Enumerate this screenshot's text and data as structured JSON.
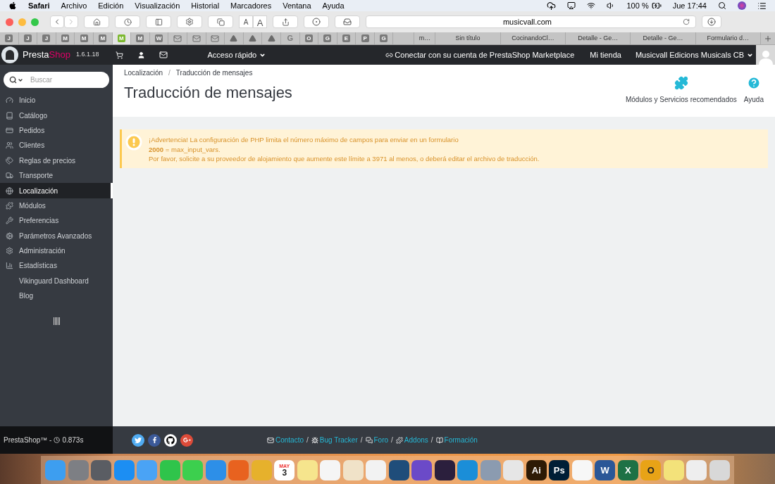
{
  "menu_bar": {
    "app": "Safari",
    "menus": [
      "Archivo",
      "Edición",
      "Visualización",
      "Historial",
      "Marcadores",
      "Ventana",
      "Ayuda"
    ],
    "battery": "100 %",
    "clock": "Jue 17:44"
  },
  "toolbar": {
    "font_buttons": [
      "A",
      "A"
    ],
    "url": "musicvall.com"
  },
  "favorite_tabs": [
    {
      "kind": "letter",
      "label": "J",
      "selected": false
    },
    {
      "kind": "letter",
      "label": "J",
      "selected": false
    },
    {
      "kind": "letter",
      "label": "J",
      "selected": false
    },
    {
      "kind": "letter",
      "label": "M",
      "selected": false
    },
    {
      "kind": "letter",
      "label": "M",
      "selected": false
    },
    {
      "kind": "letter",
      "label": "M",
      "selected": false
    },
    {
      "kind": "letter",
      "label": "M",
      "selected": true
    },
    {
      "kind": "letter",
      "label": "M",
      "selected": false
    },
    {
      "kind": "letter",
      "label": "W",
      "selected": false
    },
    {
      "kind": "mail",
      "selected": false
    },
    {
      "kind": "mail",
      "selected": false
    },
    {
      "kind": "mail",
      "selected": false
    },
    {
      "kind": "drive",
      "selected": false
    },
    {
      "kind": "drive",
      "selected": false
    },
    {
      "kind": "drive",
      "selected": false
    },
    {
      "kind": "plain",
      "label": "G",
      "selected": false
    },
    {
      "kind": "letter",
      "label": "O",
      "selected": false
    },
    {
      "kind": "letter",
      "label": "G",
      "selected": false
    },
    {
      "kind": "letter",
      "label": "E",
      "selected": false
    },
    {
      "kind": "letter",
      "label": "P",
      "selected": false
    },
    {
      "kind": "letter",
      "label": "G",
      "selected": false
    }
  ],
  "page_tabs": [
    {
      "label": "m…",
      "selected": false
    },
    {
      "label": "Sin título",
      "selected": false
    },
    {
      "label": "CocinandoCl…",
      "selected": false
    },
    {
      "label": "Detalle - Ge…",
      "selected": false
    },
    {
      "label": "Detalle - Ge…",
      "selected": false
    },
    {
      "label": "Formulario d…",
      "selected": false
    }
  ],
  "header": {
    "brand_prefix": "Presta",
    "brand_suffix": "Shop",
    "version": "1.6.1.18",
    "quick_access": "Acceso rápido",
    "marketplace": "Conectar con su cuenta de PrestaShop Marketplace",
    "my_store": "Mi tienda",
    "account": "Musicvall Edicions Musicals CB"
  },
  "sidebar": {
    "search_placeholder": "Buscar",
    "items": [
      {
        "label": "Inicio",
        "selected": false
      },
      {
        "label": "Catálogo",
        "selected": false
      },
      {
        "label": "Pedidos",
        "selected": false
      },
      {
        "label": "Clientes",
        "selected": false
      },
      {
        "label": "Reglas de precios",
        "selected": false
      },
      {
        "label": "Transporte",
        "selected": false
      },
      {
        "label": "Localización",
        "selected": true
      },
      {
        "label": "Módulos",
        "selected": false
      },
      {
        "label": "Preferencias",
        "selected": false
      },
      {
        "label": "Parámetros Avanzados",
        "selected": false
      },
      {
        "label": "Administración",
        "selected": false
      },
      {
        "label": "Estadísticas",
        "selected": false
      },
      {
        "label": "Vikinguard Dashboard",
        "selected": false
      },
      {
        "label": "Blog",
        "selected": false
      }
    ]
  },
  "breadcrumb": [
    "Localización",
    "Traducción de mensajes"
  ],
  "breadcrumb_separator": "/",
  "title": "Traducción de mensajes",
  "toolbar_buttons": [
    {
      "kind": "modules",
      "label": "Módulos y Servicios recomendados"
    },
    {
      "kind": "help",
      "label": "Ayuda"
    }
  ],
  "warning": {
    "lines": [
      "¡Advertencia! La configuración de PHP limita el número máximo de campos para enviar en un formulario",
      "**2000** = max_input_vars.",
      "Por favor, solicite a su proveedor de alojamiento que aumente este límite a 3971 al menos, o deberá editar el archivo de traducción."
    ]
  },
  "footer": {
    "brand": "PrestaShop™ -",
    "time": "0.873s",
    "links": [
      {
        "kind": "mail",
        "label": "Contacto"
      },
      {
        "kind": "bug",
        "label": "Bug Tracker"
      },
      {
        "kind": "chat",
        "label": "Foro"
      },
      {
        "kind": "puzzle",
        "label": "Addons"
      },
      {
        "kind": "book",
        "label": "Formación"
      }
    ],
    "separator": "/"
  },
  "dock": [
    {
      "color": "#3d9ef0"
    },
    {
      "color": "#7d7f84"
    },
    {
      "color": "#5a5d63"
    },
    {
      "color": "#1c8ef3"
    },
    {
      "color": "#4aa3f5"
    },
    {
      "color": "#2fc44b"
    },
    {
      "color": "#3ccf4e"
    },
    {
      "color": "#2d8fe8"
    },
    {
      "color": "#e8621f"
    },
    {
      "color": "#e6b12c"
    },
    {
      "color": "#ffffff",
      "label": "3",
      "sublabel": "MAY"
    },
    {
      "color": "#f6e58d"
    },
    {
      "color": "#f5f5f5"
    },
    {
      "color": "#f0e2c8"
    },
    {
      "color": "#f2f2f2"
    },
    {
      "color": "#1f4d7a"
    },
    {
      "color": "#6b4ac8"
    },
    {
      "color": "#2b1f3d"
    },
    {
      "color": "#1b8ed8"
    },
    {
      "color": "#8b9bb0"
    },
    {
      "color": "#e6e6e6"
    },
    {
      "color": "#2d1a05",
      "label": "Ai"
    },
    {
      "color": "#001e36",
      "label": "Ps"
    },
    {
      "color": "#f7f7f7"
    },
    {
      "color": "#2b5797",
      "label": "W"
    },
    {
      "color": "#1e7145",
      "label": "X"
    },
    {
      "color": "#e8a317",
      "label": "O"
    },
    {
      "color": "#f3e27a"
    },
    {
      "color": "#eeeeee"
    },
    {
      "color": "#d8d8d8"
    }
  ]
}
